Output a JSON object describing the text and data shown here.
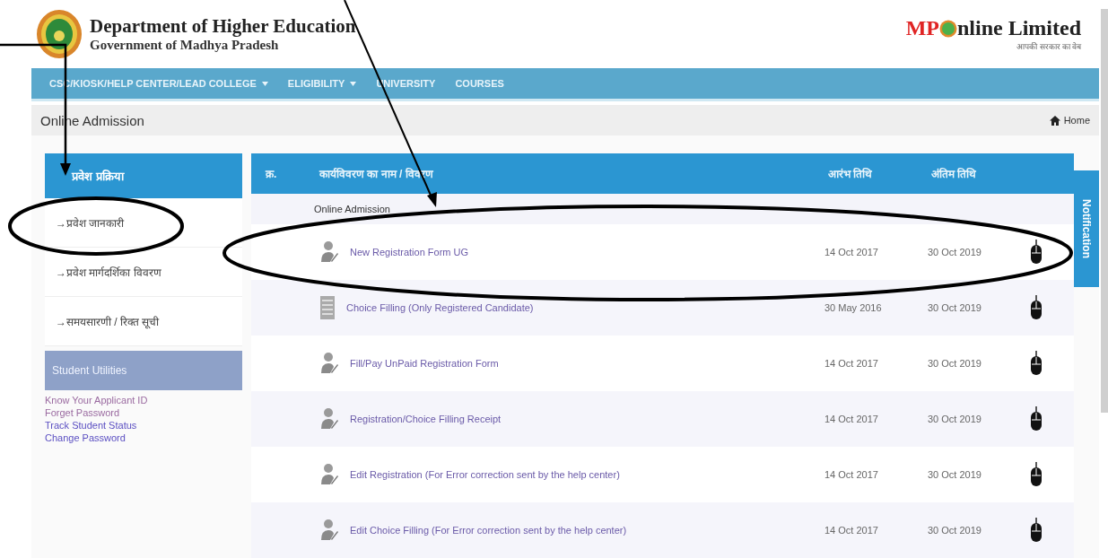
{
  "header": {
    "title": "Department of Higher Education",
    "subtitle": "Government of Madhya Pradesh",
    "partner": {
      "brand_left": "MP",
      "brand_right": "nline Limited",
      "tagline": "आपकी सरकार का वेब"
    }
  },
  "nav": [
    {
      "label": "CSC/KIOSK/HELP CENTER/LEAD COLLEGE",
      "dropdown": true
    },
    {
      "label": "ELIGIBILITY",
      "dropdown": true
    },
    {
      "label": "UNIVERSITY",
      "dropdown": false
    },
    {
      "label": "COURSES",
      "dropdown": false
    }
  ],
  "breadcrumb": {
    "title": "Online Admission",
    "home": "Home"
  },
  "sidebar": {
    "header": "प्रवेश प्रक्रिया",
    "items": [
      "→प्रवेश जानकारी",
      "→प्रवेश मार्गदर्शिका विवरण",
      "→समयसारणी / रिक्त सूची"
    ],
    "utilities": {
      "header": "Student Utilities",
      "links": [
        "Know Your Applicant ID",
        "Forget Password",
        "Track Student Status",
        "Change Password"
      ]
    }
  },
  "table": {
    "columns": [
      "क्र.",
      "कार्यविवरण का नाम / विवरण",
      "आरंभ तिथि",
      "अंतिम तिथि"
    ],
    "group": "Online Admission",
    "rows": [
      {
        "kind": "person",
        "title": "New Registration Form UG",
        "start": "14 Oct 2017",
        "end": "30 Oct 2019"
      },
      {
        "kind": "document",
        "title": "Choice Filling (Only Registered Candidate)",
        "start": "30 May 2016",
        "end": "30 Oct 2019"
      },
      {
        "kind": "person",
        "title": "Fill/Pay UnPaid Registration Form",
        "start": "14 Oct 2017",
        "end": "30 Oct 2019"
      },
      {
        "kind": "person",
        "title": "Registration/Choice Filling Receipt",
        "start": "14 Oct 2017",
        "end": "30 Oct 2019"
      },
      {
        "kind": "person",
        "title": "Edit Registration (For Error correction sent by the help center)",
        "start": "14 Oct 2017",
        "end": "30 Oct 2019"
      },
      {
        "kind": "person",
        "title": "Edit Choice Filling (For Error correction sent by the help center)",
        "start": "14 Oct 2017",
        "end": "30 Oct 2019"
      }
    ]
  },
  "notification_tab": "Notification"
}
